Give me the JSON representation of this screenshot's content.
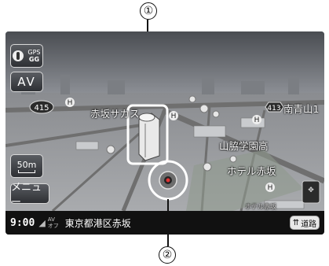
{
  "callouts": {
    "one": "①",
    "two": "②"
  },
  "buttons": {
    "gps_line1": "GPS",
    "gps_line2": "GG",
    "av_label": "AV",
    "scale_label": "50m",
    "menu_label": "メニュー",
    "road_label": "道路"
  },
  "map_labels": {
    "route415": "415",
    "route413": "413",
    "minami_aoyama": "南青山1",
    "akasaka_area": "赤坂サカス",
    "gakuen": "山脇学園高",
    "hotel": "ホテル赤坂",
    "marker_h": "H",
    "small_text": "ホテル赤坂"
  },
  "status": {
    "time": "9:00",
    "mode_top": "AV",
    "mode_bottom": "オフ",
    "address": "東京都港区赤坂"
  },
  "colors": {
    "highlight_ring": "#ffffff",
    "building": "#e9e9e9",
    "road": "#6f6f6f"
  }
}
